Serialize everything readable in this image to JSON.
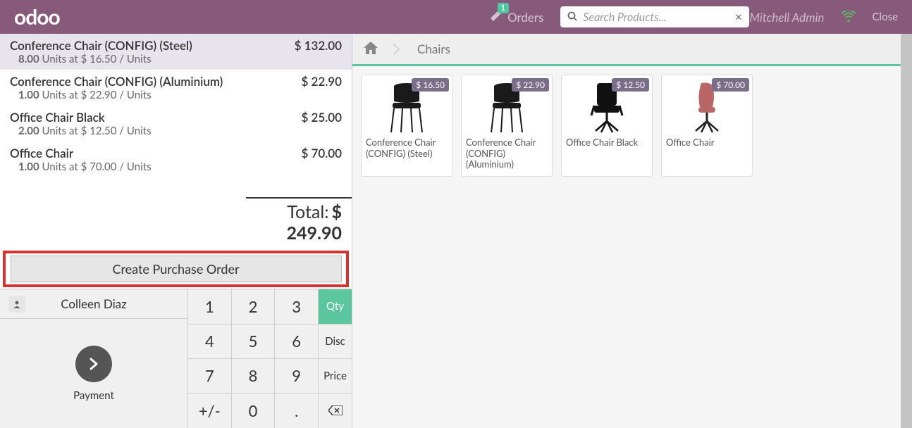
{
  "header": {
    "logo": "odoo",
    "orders_label": "Orders",
    "orders_count": "1",
    "search_placeholder": "Search Products...",
    "user": "Mitchell Admin",
    "close": "Close"
  },
  "order": {
    "lines": [
      {
        "name": "Conference Chair (CONFIG) (Steel)",
        "qty": "8.00",
        "unit": "Units at $ 16.50 / Units",
        "price": "$ 132.00",
        "selected": true
      },
      {
        "name": "Conference Chair (CONFIG) (Aluminium)",
        "qty": "1.00",
        "unit": "Units at $ 22.90 / Units",
        "price": "$ 22.90",
        "selected": false
      },
      {
        "name": "Office Chair Black",
        "qty": "2.00",
        "unit": "Units at $ 12.50 / Units",
        "price": "$ 25.00",
        "selected": false
      },
      {
        "name": "Office Chair",
        "qty": "1.00",
        "unit": "Units at $ 70.00 / Units",
        "price": "$ 70.00",
        "selected": false
      }
    ],
    "total_label": "Total:",
    "total_value": "$ 249.90"
  },
  "cpo": {
    "label": "Create Purchase Order"
  },
  "actionpad": {
    "customer": "Colleen Diaz",
    "payment": "Payment",
    "keys": {
      "k1": "1",
      "k2": "2",
      "k3": "3",
      "kqty": "Qty",
      "k4": "4",
      "k5": "5",
      "k6": "6",
      "kdisc": "Disc",
      "k7": "7",
      "k8": "8",
      "k9": "9",
      "kprice": "Price",
      "kpm": "+/-",
      "k0": "0",
      "kdot": ".",
      "kbs": "⌫"
    }
  },
  "breadcrumb": {
    "category": "Chairs"
  },
  "products": [
    {
      "name": "Conference Chair (CONFIG) (Steel)",
      "price": "$ 16.50"
    },
    {
      "name": "Conference Chair (CONFIG) (Aluminium)",
      "price": "$ 22.90"
    },
    {
      "name": "Office Chair Black",
      "price": "$ 12.50"
    },
    {
      "name": "Office Chair",
      "price": "$ 70.00"
    }
  ]
}
